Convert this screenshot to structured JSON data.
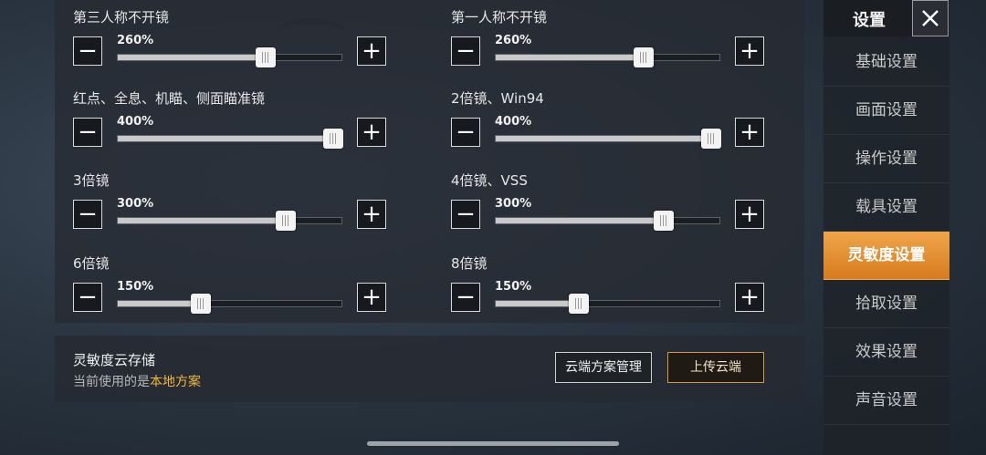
{
  "sidebar": {
    "title": "设置",
    "items": [
      {
        "label": "基础设置",
        "active": false
      },
      {
        "label": "画面设置",
        "active": false
      },
      {
        "label": "操作设置",
        "active": false
      },
      {
        "label": "载具设置",
        "active": false
      },
      {
        "label": "灵敏度设置",
        "active": true
      },
      {
        "label": "拾取设置",
        "active": false
      },
      {
        "label": "效果设置",
        "active": false
      },
      {
        "label": "声音设置",
        "active": false
      }
    ]
  },
  "sliders": [
    {
      "label": "第三人称不开镜",
      "value_text": "260%",
      "fraction": 0.66
    },
    {
      "label": "第一人称不开镜",
      "value_text": "260%",
      "fraction": 0.66
    },
    {
      "label": "红点、全息、机瞄、侧面瞄准镜",
      "value_text": "400%",
      "fraction": 1.0
    },
    {
      "label": "2倍镜、Win94",
      "value_text": "400%",
      "fraction": 1.0
    },
    {
      "label": "3倍镜",
      "value_text": "300%",
      "fraction": 0.75
    },
    {
      "label": "4倍镜、VSS",
      "value_text": "300%",
      "fraction": 0.75
    },
    {
      "label": "6倍镜",
      "value_text": "150%",
      "fraction": 0.37
    },
    {
      "label": "8倍镜",
      "value_text": "150%",
      "fraction": 0.37
    }
  ],
  "controls": {
    "minus": "−",
    "plus": "+"
  },
  "cloud": {
    "title": "灵敏度云存储",
    "sub_prefix": "当前使用的是",
    "sub_highlight": "本地方案",
    "manage_label": "云端方案管理",
    "upload_label": "上传云端"
  },
  "colors": {
    "accent": "#e3902f",
    "highlight": "#f2b640"
  }
}
